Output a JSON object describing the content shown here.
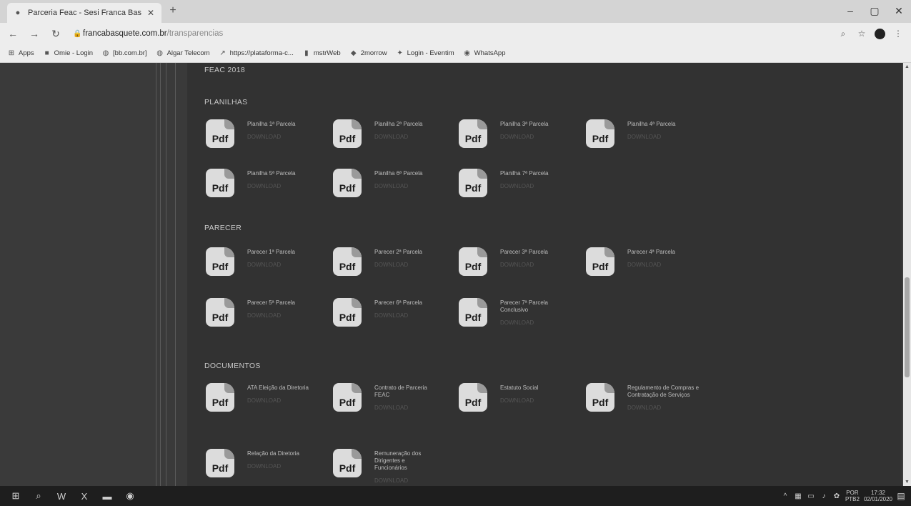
{
  "browser": {
    "tab_title": "Parceria Feac - Sesi Franca Basq...",
    "url_host": "francabasquete.com.br",
    "url_path": "/transparencias",
    "bookmarks": [
      "Apps",
      "Omie - Login",
      "[bb.com.br]",
      "Algar Telecom",
      "https://plataforma-c...",
      "mstrWeb",
      "2morrow",
      "Login - Eventim",
      "WhatsApp"
    ]
  },
  "page": {
    "heading_top": "FEAC 2018",
    "sections": [
      {
        "title": "PLANILHAS",
        "docs": [
          {
            "name": "Planilha 1ª Parcela",
            "link": "DOWNLOAD"
          },
          {
            "name": "Planilha 2ª Parcela",
            "link": "DOWNLOAD"
          },
          {
            "name": "Planilha 3ª Parcela",
            "link": "DOWNLOAD"
          },
          {
            "name": "Planilha 4ª Parcela",
            "link": "DOWNLOAD"
          },
          {
            "name": "Planilha 5ª Parcela",
            "link": "DOWNLOAD"
          },
          {
            "name": "Planilha 6ª Parcela",
            "link": "DOWNLOAD"
          },
          {
            "name": "Planilha 7ª Parcela",
            "link": "DOWNLOAD"
          }
        ]
      },
      {
        "title": "PARECER",
        "docs": [
          {
            "name": "Parecer 1ª Parcela",
            "link": "DOWNLOAD"
          },
          {
            "name": "Parecer 2ª Parcela",
            "link": "DOWNLOAD"
          },
          {
            "name": "Parecer 3ª Parcela",
            "link": "DOWNLOAD"
          },
          {
            "name": "Parecer 4ª Parcela",
            "link": "DOWNLOAD"
          },
          {
            "name": "Parecer 5ª Parcela",
            "link": "DOWNLOAD"
          },
          {
            "name": "Parecer 6ª Parcela",
            "link": "DOWNLOAD"
          },
          {
            "name": "Parecer 7ª Parcela Conclusivo",
            "link": "DOWNLOAD"
          }
        ]
      },
      {
        "title": "DOCUMENTOS",
        "docs": [
          {
            "name": "ATA Eleição da Diretoria",
            "link": "DOWNLOAD"
          },
          {
            "name": "Contrato de Parceria FEAC",
            "link": "DOWNLOAD"
          },
          {
            "name": "Estatuto Social",
            "link": "DOWNLOAD"
          },
          {
            "name": "Regulamento de Compras e Contratação de Serviços",
            "link": "DOWNLOAD"
          },
          {
            "name": "Relação da Diretoria",
            "link": "DOWNLOAD"
          },
          {
            "name": "Remuneração dos Dirigentes e Funcionários",
            "link": "DOWNLOAD"
          }
        ]
      }
    ],
    "pdf_label": "Pdf"
  },
  "taskbar": {
    "lang": "POR",
    "layout": "PTB2",
    "time": "17:32",
    "date": "02/01/2020"
  },
  "colors": {
    "page_bg": "#323232",
    "badge_bg": "#dcdcdc",
    "taskbar_bg": "#1e1e1e"
  }
}
